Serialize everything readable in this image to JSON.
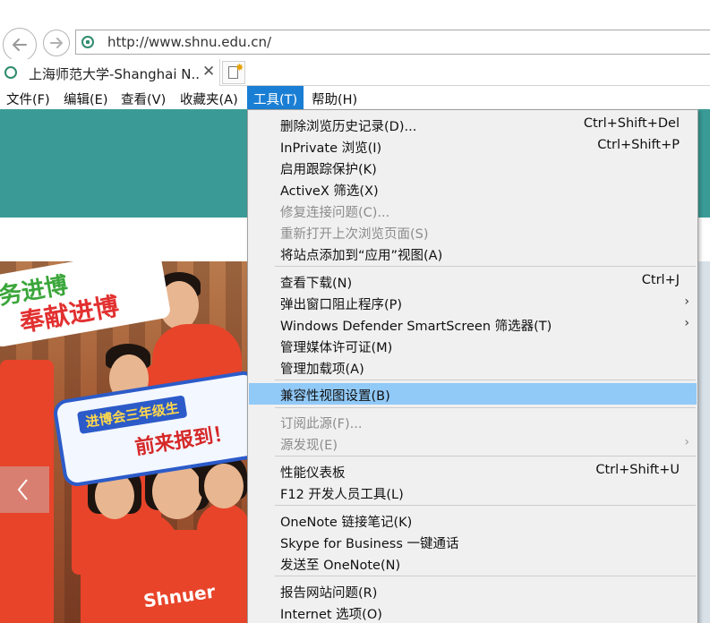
{
  "browser": {
    "address": "http://www.shnu.edu.cn/",
    "tab_title": "上海师范大学-Shanghai N...",
    "tab_close": "✕"
  },
  "menubar": {
    "file": "文件(F)",
    "edit": "编辑(E)",
    "view": "查看(V)",
    "favorites": "收藏夹(A)",
    "tools": "工具(T)",
    "help": "帮助(H)"
  },
  "page": {
    "sign1_line1": "务进博",
    "sign1_line2": "奉献进博",
    "sign2_line1": "进博会三年级生",
    "sign2_line2": "前来报到！",
    "shirt_text": "Shnuer"
  },
  "tools_menu": {
    "delete_history": {
      "label": "删除浏览历史记录(D)...",
      "shortcut": "Ctrl+Shift+Del"
    },
    "inprivate": {
      "label": "InPrivate 浏览(I)",
      "shortcut": "Ctrl+Shift+P"
    },
    "tracking_protection": {
      "label": "启用跟踪保护(K)"
    },
    "activex": {
      "label": "ActiveX 筛选(X)"
    },
    "fix_connection": {
      "label": "修复连接问题(C)..."
    },
    "reopen_session": {
      "label": "重新打开上次浏览页面(S)"
    },
    "add_to_apps": {
      "label": "将站点添加到“应用”视图(A)"
    },
    "view_downloads": {
      "label": "查看下载(N)",
      "shortcut": "Ctrl+J"
    },
    "popup_blocker": {
      "label": "弹出窗口阻止程序(P)",
      "arrow": "›"
    },
    "smartscreen": {
      "label": "Windows Defender SmartScreen 筛选器(T)",
      "arrow": "›"
    },
    "media_licenses": {
      "label": "管理媒体许可证(M)"
    },
    "manage_addons": {
      "label": "管理加载项(A)"
    },
    "compat_view": {
      "label": "兼容性视图设置(B)"
    },
    "subscribe_feed": {
      "label": "订阅此源(F)..."
    },
    "feed_discovery": {
      "label": "源发现(E)",
      "arrow": "›"
    },
    "perf_dashboard": {
      "label": "性能仪表板",
      "shortcut": "Ctrl+Shift+U"
    },
    "f12_tools": {
      "label": "F12 开发人员工具(L)"
    },
    "onenote_linked": {
      "label": "OneNote 链接笔记(K)"
    },
    "skype": {
      "label": "Skype for Business 一键通话"
    },
    "send_onenote": {
      "label": "发送至 OneNote(N)"
    },
    "report_problems": {
      "label": "报告网站问题(R)"
    },
    "internet_options": {
      "label": "Internet 选项(O)"
    }
  },
  "colors": {
    "menu_active": "#1a7fd4",
    "menu_highlight": "#91c9f7",
    "banner": "#3a9b96"
  }
}
